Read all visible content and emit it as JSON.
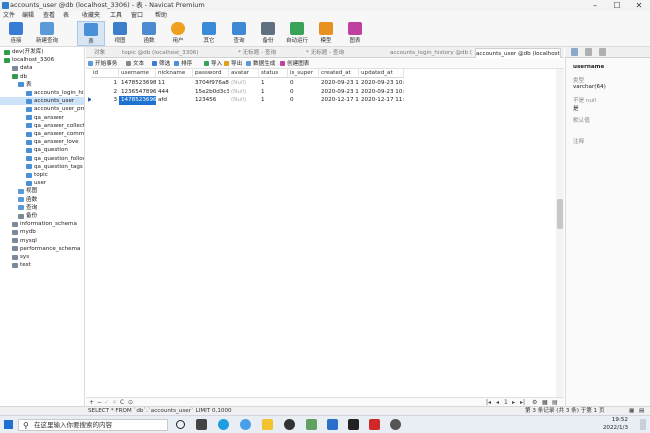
{
  "window": {
    "title": "accounts_user @db (localhost_3306) - 表 - Navicat Premium"
  },
  "menu": [
    "文件",
    "编辑",
    "查看",
    "表",
    "收藏夹",
    "工具",
    "窗口",
    "帮助"
  ],
  "toolbar": [
    {
      "label": "连接",
      "icon": "plug-icon",
      "color": "#3a7bd5"
    },
    {
      "label": "新建查询",
      "icon": "new-query-icon",
      "color": "#5a9ad8"
    },
    {
      "label": "表",
      "icon": "table-icon",
      "color": "#4a90d9"
    },
    {
      "label": "视图",
      "icon": "view-icon",
      "color": "#3d7ecb"
    },
    {
      "label": "函数",
      "icon": "function-icon",
      "color": "#4d8bd0"
    },
    {
      "label": "用户",
      "icon": "user-icon",
      "color": "#f0a020"
    },
    {
      "label": "其它",
      "icon": "tools-icon",
      "color": "#3a8ad8"
    },
    {
      "label": "查询",
      "icon": "query-icon",
      "color": "#3e88d6"
    },
    {
      "label": "备份",
      "icon": "backup-icon",
      "color": "#607080"
    },
    {
      "label": "自动运行",
      "icon": "autorun-icon",
      "color": "#3aa35a"
    },
    {
      "label": "模型",
      "icon": "model-icon",
      "color": "#e89020"
    },
    {
      "label": "图表",
      "icon": "chart-icon",
      "color": "#c040a0"
    }
  ],
  "tree": [
    {
      "label": "dev(开发库)",
      "level": 0,
      "icon": "connection-icon",
      "color": "#2e9e4e"
    },
    {
      "label": "localhost_3306",
      "level": 0,
      "icon": "connection-icon",
      "color": "#2e9e4e"
    },
    {
      "label": "data",
      "level": 1,
      "icon": "database-icon",
      "color": "#7a8a9a"
    },
    {
      "label": "db",
      "level": 1,
      "icon": "database-icon",
      "color": "#2e9e4e"
    },
    {
      "label": "表",
      "level": 2,
      "icon": "table-group-icon",
      "color": "#4a90d9"
    },
    {
      "label": "accounts_login_history",
      "level": 3,
      "icon": "table-icon",
      "color": "#4a90d9"
    },
    {
      "label": "accounts_user",
      "level": 3,
      "icon": "table-icon",
      "color": "#4a90d9",
      "selected": true
    },
    {
      "label": "accounts_user_profile",
      "level": 3,
      "icon": "table-icon",
      "color": "#4a90d9"
    },
    {
      "label": "qa_answer",
      "level": 3,
      "icon": "table-icon",
      "color": "#4a90d9"
    },
    {
      "label": "qa_answer_collect",
      "level": 3,
      "icon": "table-icon",
      "color": "#4a90d9"
    },
    {
      "label": "qa_answer_comment",
      "level": 3,
      "icon": "table-icon",
      "color": "#4a90d9"
    },
    {
      "label": "qa_answer_love",
      "level": 3,
      "icon": "table-icon",
      "color": "#4a90d9"
    },
    {
      "label": "qa_question",
      "level": 3,
      "icon": "table-icon",
      "color": "#4a90d9"
    },
    {
      "label": "qa_question_follow",
      "level": 3,
      "icon": "table-icon",
      "color": "#4a90d9"
    },
    {
      "label": "qa_question_tags",
      "level": 3,
      "icon": "table-icon",
      "color": "#4a90d9"
    },
    {
      "label": "topic",
      "level": 3,
      "icon": "table-icon",
      "color": "#4a90d9"
    },
    {
      "label": "user",
      "level": 3,
      "icon": "table-icon",
      "color": "#4a90d9"
    },
    {
      "label": "视图",
      "level": 2,
      "icon": "view-icon",
      "color": "#5a9ad8"
    },
    {
      "label": "函数",
      "level": 2,
      "icon": "function-icon",
      "color": "#5a9ad8"
    },
    {
      "label": "查询",
      "level": 2,
      "icon": "query-icon",
      "color": "#5a9ad8"
    },
    {
      "label": "备份",
      "level": 2,
      "icon": "backup-icon",
      "color": "#7a8a9a"
    },
    {
      "label": "information_schema",
      "level": 1,
      "icon": "database-icon",
      "color": "#7a8a9a"
    },
    {
      "label": "mydb",
      "level": 1,
      "icon": "database-icon",
      "color": "#7a8a9a"
    },
    {
      "label": "mysql",
      "level": 1,
      "icon": "database-icon",
      "color": "#7a8a9a"
    },
    {
      "label": "performance_schema",
      "level": 1,
      "icon": "database-icon",
      "color": "#7a8a9a"
    },
    {
      "label": "sys",
      "level": 1,
      "icon": "database-icon",
      "color": "#7a8a9a"
    },
    {
      "label": "test",
      "level": 1,
      "icon": "database-icon",
      "color": "#7a8a9a"
    }
  ],
  "tabs": [
    "对象",
    "topic @db (localhost_3306) - ...",
    "* 无标题 - 查询",
    "* 无标题 - 查询",
    "accounts_login_history @db (l...",
    "accounts_user @db (localhost..."
  ],
  "subtoolbar": [
    "开始事务",
    "文本",
    "筛选",
    "排序",
    "导入",
    "导出",
    "数据生成",
    "创建图表"
  ],
  "grid": {
    "columns": [
      "id",
      "username",
      "nickname",
      "password",
      "avatar",
      "status",
      "is_super",
      "created_at",
      "updated_at"
    ],
    "rows": [
      [
        "1",
        "147852369871",
        "11",
        "3704f976a8ac",
        "(Null)",
        "1",
        "0",
        "2020-09-23 10:2",
        "2020-09-23 10:2"
      ],
      [
        "2",
        "123654789631",
        "444",
        "15e2b0d3c338",
        "(Null)",
        "1",
        "0",
        "2020-09-23 10:2",
        "2020-09-23 10:2"
      ],
      [
        "3",
        "14785236965",
        "afd",
        "123456",
        "(Null)",
        "1",
        "0",
        "2020-12-17 11:1",
        "2020-12-17 11:1"
      ]
    ],
    "selected_row": 2,
    "selected_cell": "14785236965"
  },
  "gridfoot": {
    "nav": [
      "+",
      "−",
      "✓",
      "✕",
      "C",
      "⊙"
    ],
    "page": "1"
  },
  "props": {
    "title": "username",
    "type_key": "类型",
    "type_val": "varchar(64)",
    "null_key": "不是 null",
    "null_val": "是",
    "default_key": "默认值",
    "comment_key": "注释"
  },
  "status": {
    "sql": "SELECT * FROM `db`.`accounts_user` LIMIT 0,1000",
    "records": "第 3 条记录 (共 3 条) 于第 1 页"
  },
  "taskbar": {
    "search_placeholder": "在这里输入你要搜索的内容",
    "time": "19:52",
    "date": "2022/1/3"
  }
}
